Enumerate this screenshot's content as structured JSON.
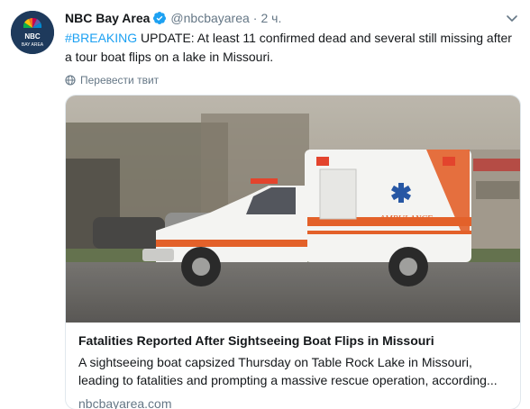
{
  "tweet": {
    "author": {
      "display_name": "NBC Bay Area",
      "handle": "@nbcbayarea",
      "avatar_text_top": "NBC",
      "avatar_text_bottom": "BAY AREA",
      "verified": true
    },
    "separator": "·",
    "timestamp": "2 ч.",
    "hashtag": "#BREAKING",
    "text": " UPDATE: At least 11 confirmed dead and several still missing after a tour boat flips on a lake in Missouri.",
    "translate_label": "Перевести твит"
  },
  "card": {
    "image_icon": "ambulance-photo",
    "title": "Fatalities Reported After Sightseeing Boat Flips in Missouri",
    "description": "A sightseeing boat capsized Thursday on Table Rock Lake in Missouri, leading to fatalities and prompting a massive rescue operation, according...",
    "domain": "nbcbayarea.com"
  },
  "colors": {
    "link": "#1da1f2",
    "secondary_text": "#657786",
    "primary_text": "#14171a",
    "border": "#e1e8ed",
    "avatar_bg": "#1e3a5c"
  }
}
